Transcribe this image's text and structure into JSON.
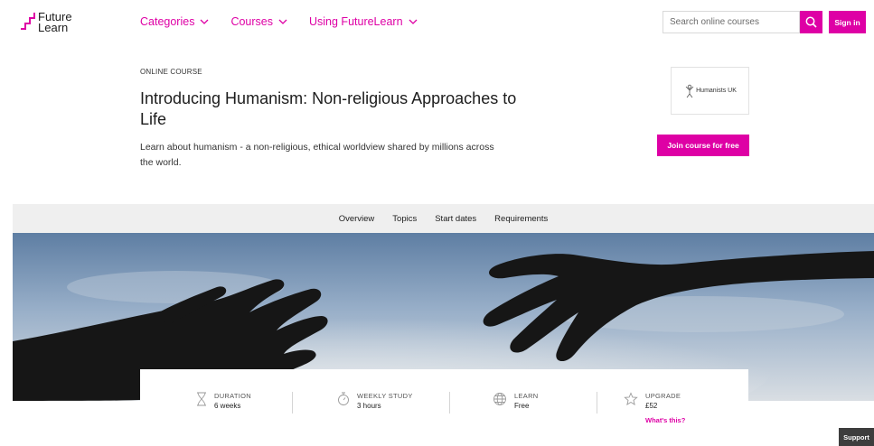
{
  "header": {
    "logo_line1": "Future",
    "logo_line2": "Learn",
    "nav": [
      {
        "label": "Categories"
      },
      {
        "label": "Courses"
      },
      {
        "label": "Using FutureLearn"
      }
    ],
    "search_placeholder": "Search online courses",
    "signin_label": "Sign in"
  },
  "course": {
    "eyebrow": "ONLINE COURSE",
    "title": "Introducing Humanism: Non-religious Approaches to Life",
    "description": "Learn about humanism - a non-religious, ethical worldview shared by millions across the world.",
    "partner_name": "Humanists UK",
    "join_label": "Join course for free"
  },
  "subnav": [
    {
      "label": "Overview"
    },
    {
      "label": "Topics"
    },
    {
      "label": "Start dates"
    },
    {
      "label": "Requirements"
    }
  ],
  "stats": [
    {
      "label": "DURATION",
      "value": "6 weeks",
      "icon": "hourglass-icon"
    },
    {
      "label": "WEEKLY STUDY",
      "value": "3 hours",
      "icon": "stopwatch-icon"
    },
    {
      "label": "LEARN",
      "value": "Free",
      "icon": "globe-icon"
    },
    {
      "label": "UPGRADE",
      "value": "£52",
      "link": "What's this?",
      "icon": "star-icon"
    }
  ],
  "support_label": "Support",
  "colors": {
    "brand": "#de00a5",
    "subnav_bg": "#efefef"
  }
}
